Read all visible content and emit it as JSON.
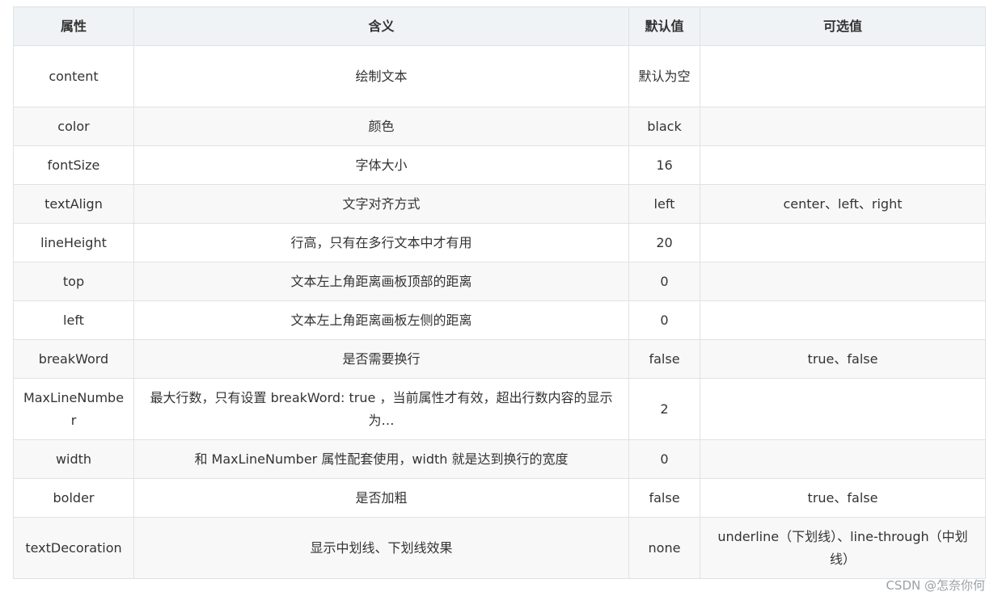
{
  "table": {
    "headers": [
      "属性",
      "含义",
      "默认值",
      "可选值"
    ],
    "rows": [
      {
        "prop": "content",
        "meaning": "绘制文本",
        "default": "默认为空",
        "options": ""
      },
      {
        "prop": "color",
        "meaning": "颜色",
        "default": "black",
        "options": ""
      },
      {
        "prop": "fontSize",
        "meaning": "字体大小",
        "default": "16",
        "options": ""
      },
      {
        "prop": "textAlign",
        "meaning": "文字对齐方式",
        "default": "left",
        "options": "center、left、right"
      },
      {
        "prop": "lineHeight",
        "meaning": "行高，只有在多行文本中才有用",
        "default": "20",
        "options": ""
      },
      {
        "prop": "top",
        "meaning": "文本左上角距离画板顶部的距离",
        "default": "0",
        "options": ""
      },
      {
        "prop": "left",
        "meaning": "文本左上角距离画板左侧的距离",
        "default": "0",
        "options": ""
      },
      {
        "prop": "breakWord",
        "meaning": "是否需要换行",
        "default": "false",
        "options": "true、false"
      },
      {
        "prop": "MaxLineNumber",
        "meaning": "最大行数，只有设置 breakWord: true ，当前属性才有效，超出行数内容的显示为…",
        "default": "2",
        "options": ""
      },
      {
        "prop": "width",
        "meaning": "和 MaxLineNumber 属性配套使用，width 就是达到换行的宽度",
        "default": "0",
        "options": ""
      },
      {
        "prop": "bolder",
        "meaning": "是否加粗",
        "default": "false",
        "options": "true、false"
      },
      {
        "prop": "textDecoration",
        "meaning": "显示中划线、下划线效果",
        "default": "none",
        "options": "underline（下划线）、line-through（中划线）"
      }
    ]
  },
  "watermark": "CSDN @怎奈你何"
}
